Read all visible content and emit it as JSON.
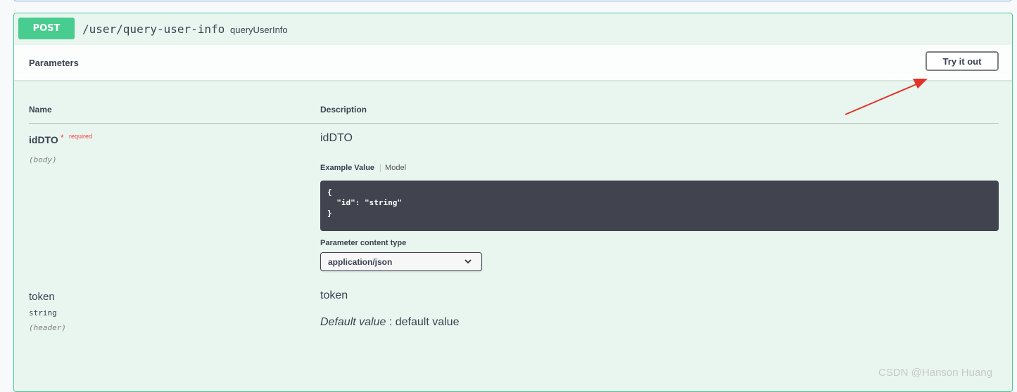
{
  "operation": {
    "method": "POST",
    "path": "/user/query-user-info",
    "operation_id": "queryUserInfo"
  },
  "parameters": {
    "title": "Parameters",
    "try_button": "Try it out",
    "col_name": "Name",
    "col_description": "Description",
    "items": [
      {
        "name": "idDTO",
        "required_star": "*",
        "required_label": "required",
        "in": "(body)",
        "description": "idDTO",
        "tab_example": "Example Value",
        "tab_model": "Model",
        "example_lines": [
          "{",
          "  \"id\": \"string\"",
          "}"
        ],
        "content_type_label": "Parameter content type",
        "content_type_value": "application/json"
      },
      {
        "name": "token",
        "type": "string",
        "in": "(header)",
        "description": "token",
        "default_label": "Default value",
        "default_sep": " : ",
        "default_value": "default value"
      }
    ]
  },
  "watermark": "CSDN @Hanson Huang",
  "colors": {
    "post_green": "#49cc90",
    "block_bg": "#e8f6ef",
    "required_red": "#f93e3e",
    "annotation_arrow": "#e53127",
    "code_bg": "#41444e"
  },
  "icons": {
    "select_chevron": "chevron-down-icon",
    "annotation": "red-arrow-annotation"
  }
}
